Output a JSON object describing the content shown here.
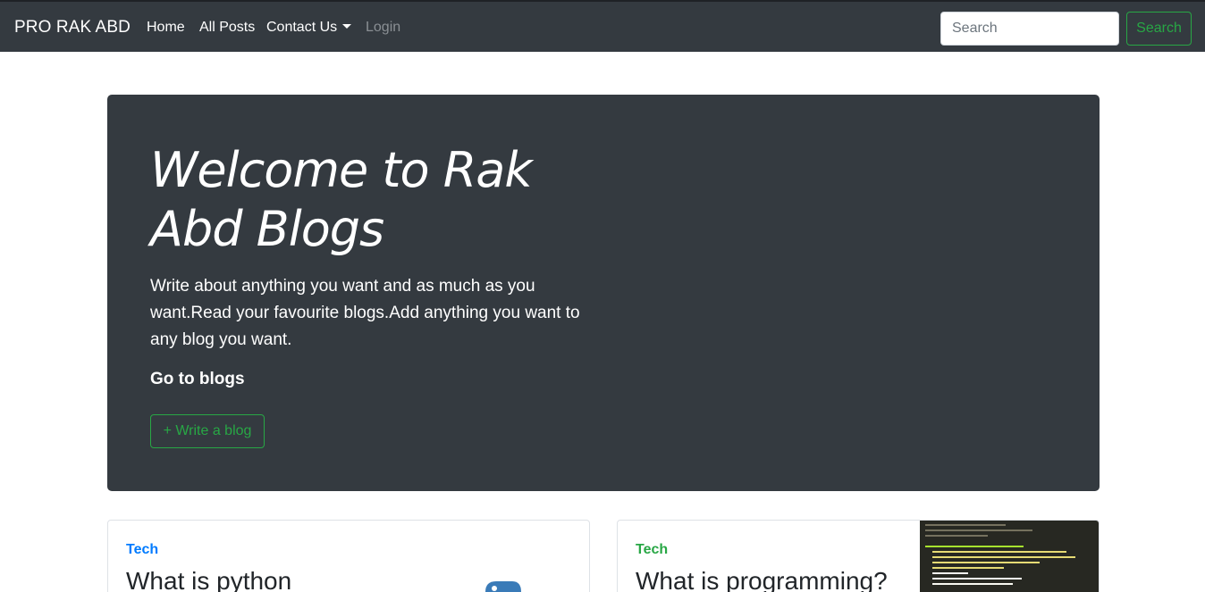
{
  "navbar": {
    "brand": "PRO RAK ABD",
    "links": [
      {
        "label": "Home"
      },
      {
        "label": "All Posts"
      },
      {
        "label": "Contact Us"
      },
      {
        "label": "Login"
      }
    ],
    "search": {
      "placeholder": "Search",
      "value": "",
      "button_label": "Search"
    }
  },
  "hero": {
    "title": "Welcome to Rak Abd Blogs",
    "lead": "Write about anything you want and as much as you want.Read your favourite blogs.Add anything you want to any blog you want.",
    "go_to_blogs": "Go to blogs",
    "write_button": "+ Write a blog"
  },
  "posts": [
    {
      "category": "Tech",
      "title": "What is python",
      "thumbnail_icon": "python-logo-icon"
    },
    {
      "category": "Tech",
      "title": "What is programming?",
      "thumbnail_icon": "code-screenshot-thumbnail"
    }
  ],
  "colors": {
    "navbar_bg": "#343a40",
    "hero_bg": "#343a40",
    "success": "#28a745",
    "primary": "#007bff"
  }
}
